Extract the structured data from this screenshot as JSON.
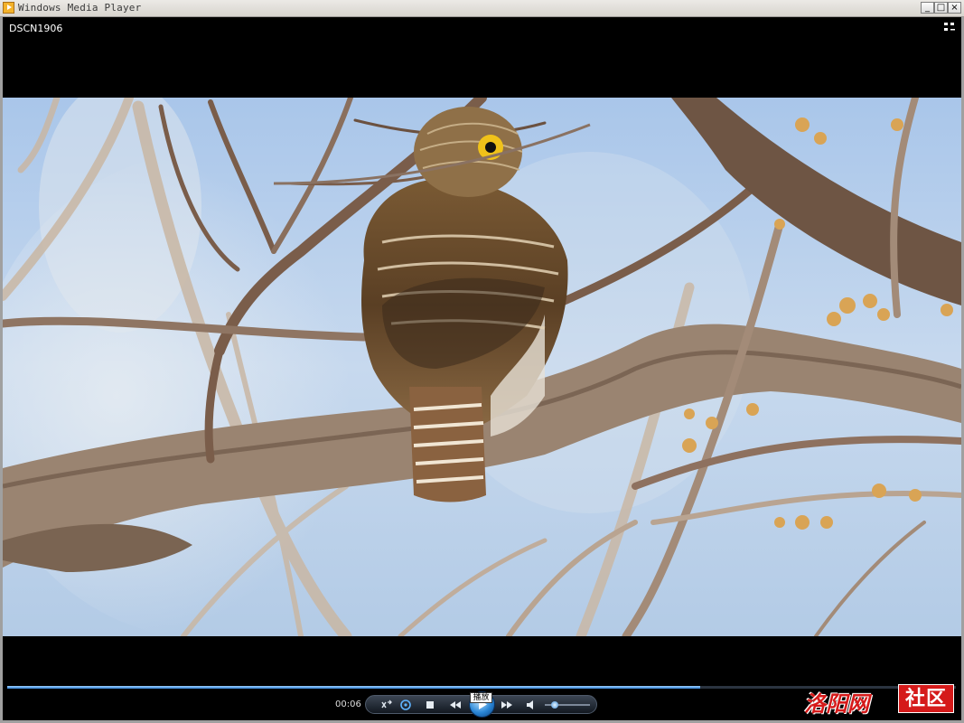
{
  "window": {
    "title": "Windows Media Player",
    "minimize_label": "_",
    "maximize_label": "□",
    "close_label": "×"
  },
  "media": {
    "title": "DSCN1906"
  },
  "playback": {
    "current_time": "00:06",
    "progress": 0.73,
    "volume": 0.22,
    "play_tooltip": "播放"
  },
  "controls": [
    {
      "name": "shuffle-icon"
    },
    {
      "name": "repeat-icon"
    },
    {
      "name": "stop-icon"
    },
    {
      "name": "previous-icon"
    },
    {
      "name": "play-icon"
    },
    {
      "name": "next-icon"
    },
    {
      "name": "mute-icon"
    }
  ],
  "watermark": {
    "cursive_text": "洛阳网",
    "box_text": "社区"
  },
  "colors": {
    "accent": "#2a86d6",
    "watermark_red": "#d51a1a",
    "sky": "#b7cfe8"
  }
}
